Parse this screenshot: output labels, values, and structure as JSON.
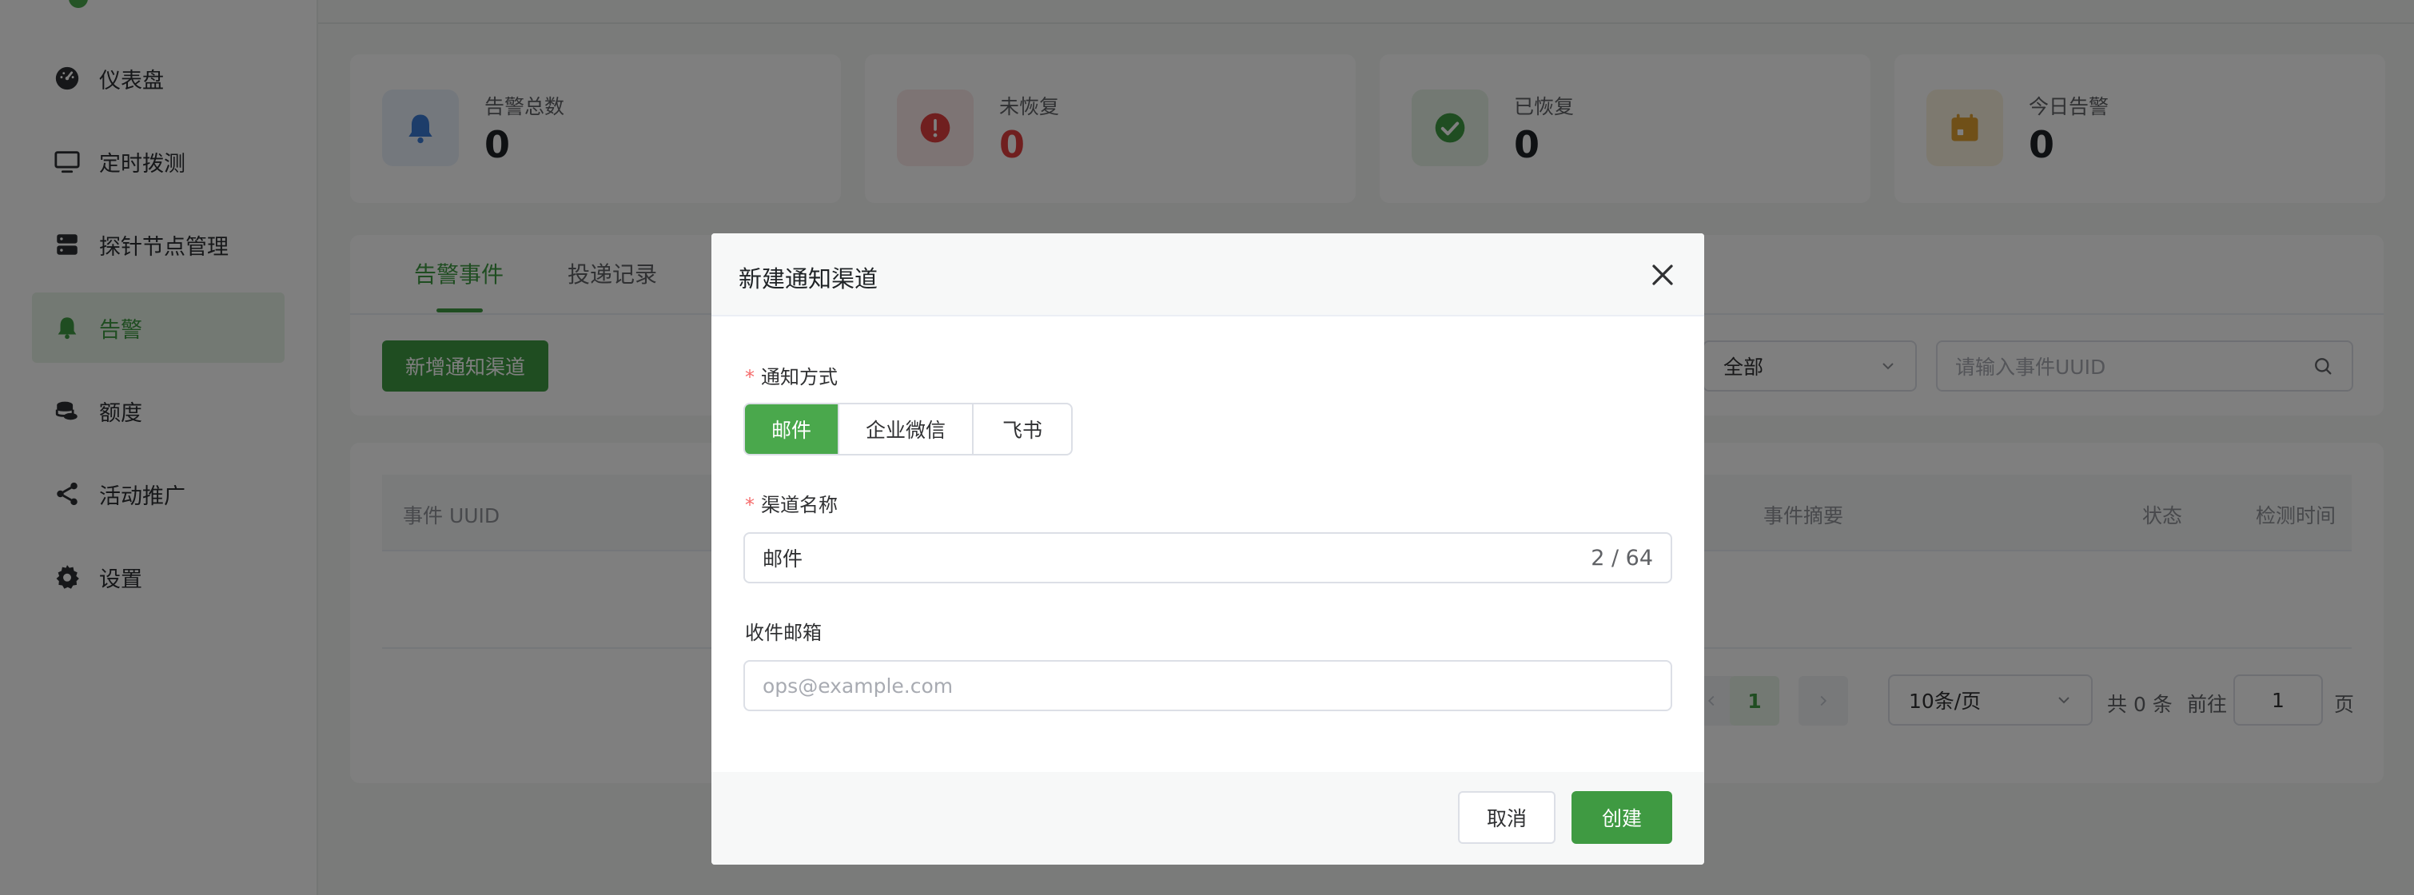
{
  "sidebar": {
    "items": [
      {
        "label": "仪表盘",
        "icon": "dashboard-icon"
      },
      {
        "label": "定时拨测",
        "icon": "monitor-icon"
      },
      {
        "label": "探针节点管理",
        "icon": "server-icon"
      },
      {
        "label": "告警",
        "icon": "bell-icon",
        "active": true
      },
      {
        "label": "额度",
        "icon": "coins-icon"
      },
      {
        "label": "活动推广",
        "icon": "share-icon"
      },
      {
        "label": "设置",
        "icon": "gear-icon"
      }
    ]
  },
  "stats": [
    {
      "title": "告警总数",
      "value": "0",
      "color": "#3a7bd5",
      "bg": "#e8f0fb"
    },
    {
      "title": "未恢复",
      "value": "0",
      "color": "#e03e3e",
      "bg": "#fbe9e9"
    },
    {
      "title": "已恢复",
      "value": "0",
      "color": "#3f9a42",
      "bg": "#e7f3e6"
    },
    {
      "title": "今日告警",
      "value": "0",
      "color": "#e0a030",
      "bg": "#fbf2df"
    }
  ],
  "tabs": [
    {
      "label": "告警事件",
      "active": true
    },
    {
      "label": "投递记录"
    }
  ],
  "toolbar": {
    "add_channel_label": "新增通知渠道",
    "status_select": "全部",
    "search_placeholder": "请输入事件UUID"
  },
  "table": {
    "columns": [
      "事件 UUID",
      "事件摘要",
      "状态",
      "检测时间"
    ]
  },
  "pagination": {
    "current_page": "1",
    "page_size": "10条/页",
    "total": "共 0 条",
    "goto_label": "前往",
    "goto_value": "1",
    "page_suffix": "页"
  },
  "dialog": {
    "title": "新建通知渠道",
    "method_label": "通知方式",
    "methods": [
      {
        "label": "邮件",
        "active": true
      },
      {
        "label": "企业微信"
      },
      {
        "label": "飞书"
      }
    ],
    "name_label": "渠道名称",
    "name_value": "邮件",
    "name_counter": "2 / 64",
    "email_label": "收件邮箱",
    "email_placeholder": "ops@example.com",
    "cancel_label": "取消",
    "create_label": "创建"
  },
  "colors": {
    "accent": "#3f9a42",
    "danger": "#e03e3e"
  }
}
